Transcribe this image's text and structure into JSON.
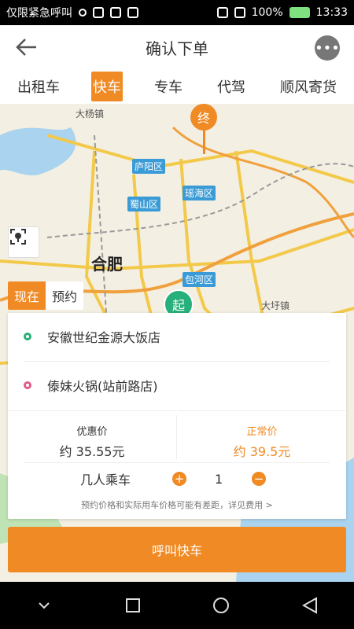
{
  "status_bar": {
    "carrier": "仅限紧急呼叫",
    "battery": "100%",
    "time": "13:33"
  },
  "header": {
    "title": "确认下单",
    "back_icon": "arrow-left-icon",
    "chat_icon": "chat-icon"
  },
  "tabs": [
    {
      "label": "出租车",
      "active": false
    },
    {
      "label": "快车",
      "active": true
    },
    {
      "label": "专车",
      "active": false
    },
    {
      "label": "代驾",
      "active": false
    },
    {
      "label": "顺风寄货",
      "active": false
    }
  ],
  "map": {
    "districts": [
      "庐阳区",
      "瑶海区",
      "蜀山区",
      "包河区"
    ],
    "towns": [
      "大杨镇",
      "大圩镇"
    ],
    "city": "合肥",
    "end_marker": "终",
    "start_marker": "起",
    "time_options": [
      {
        "label": "现在",
        "active": true
      },
      {
        "label": "预约",
        "active": false
      }
    ]
  },
  "order": {
    "pickup": "安徽世纪金源大饭店",
    "destination": "傣妹火锅(站前路店)",
    "discount_label": "优惠价",
    "discount_price": "约 35.55元",
    "normal_label": "正常价",
    "normal_price": "约 39.5元",
    "passenger_label": "几人乘车",
    "passenger_count": "1",
    "disclaimer": "预约价格和实际用车价格可能有差距，详见费用 >"
  },
  "actions": {
    "call_label": "呼叫快车"
  },
  "colors": {
    "accent": "#f08a24",
    "start": "#27b07a",
    "end": "#e25b8a",
    "district": "#3b9bd6"
  }
}
